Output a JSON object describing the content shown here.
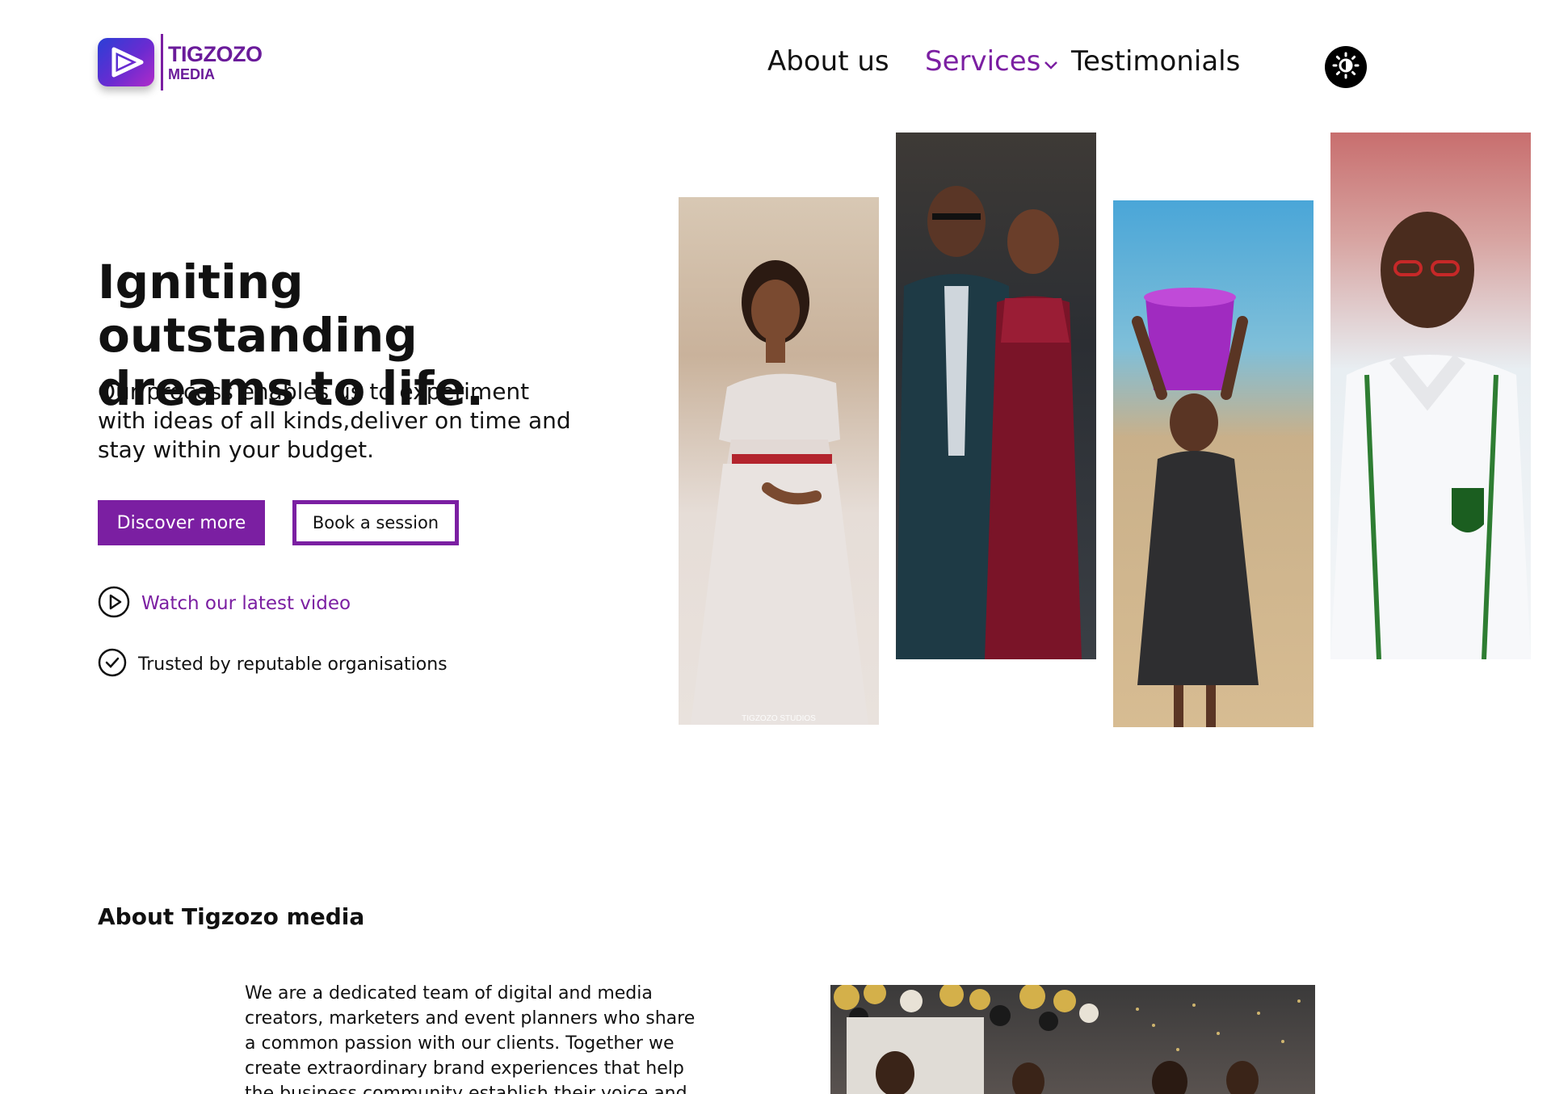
{
  "brand": {
    "name_line1": "TIGZOZO",
    "name_line2": "MEDIA",
    "color": "#7b1fa2"
  },
  "nav": {
    "items": [
      {
        "label": "About us"
      },
      {
        "label": "Services",
        "has_dropdown": true,
        "active": true
      },
      {
        "label": "Testimonials"
      }
    ],
    "theme_toggle_icon": "sun-icon"
  },
  "hero": {
    "title": "Igniting outstanding dreams to life.",
    "subtitle": "Our process enables us to experiment with ideas of all kinds,deliver on time and stay within your budget.",
    "primary_button": "Discover more",
    "secondary_button": "Book a session",
    "watch_link": "Watch our latest video",
    "trusted_text": "Trusted by reputable organisations"
  },
  "gallery": {
    "watermark": "TIGZOZO STUDIOS"
  },
  "about": {
    "heading": "About Tigzozo media",
    "text": "We are a dedicated team of digital and media creators, marketers and event planners who share a common passion with our clients. Together we create extraordinary brand experiences that help the business community establish their voice and"
  }
}
